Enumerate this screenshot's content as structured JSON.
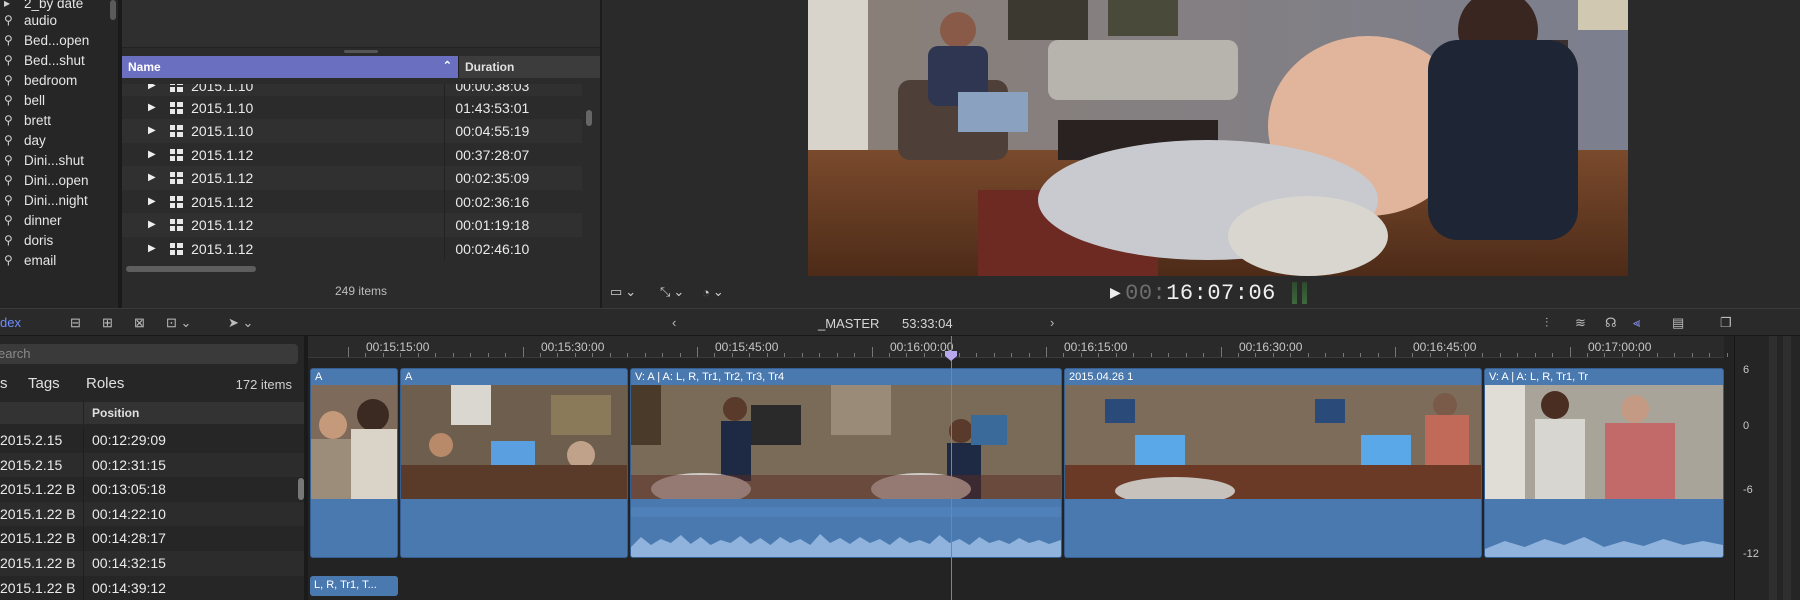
{
  "sidebar": {
    "items": [
      {
        "label": "2_by date",
        "icon": "folder-icon"
      },
      {
        "label": "audio",
        "icon": "keyword-icon"
      },
      {
        "label": "Bed...open",
        "icon": "keyword-icon"
      },
      {
        "label": "Bed...shut",
        "icon": "keyword-icon"
      },
      {
        "label": "bedroom",
        "icon": "keyword-icon"
      },
      {
        "label": "bell",
        "icon": "keyword-icon"
      },
      {
        "label": "brett",
        "icon": "keyword-icon"
      },
      {
        "label": "day",
        "icon": "keyword-icon"
      },
      {
        "label": "Dini...shut",
        "icon": "keyword-icon"
      },
      {
        "label": "Dini...open",
        "icon": "keyword-icon"
      },
      {
        "label": "Dini...night",
        "icon": "keyword-icon"
      },
      {
        "label": "dinner",
        "icon": "keyword-icon"
      },
      {
        "label": "doris",
        "icon": "keyword-icon"
      },
      {
        "label": "email",
        "icon": "keyword-icon"
      }
    ]
  },
  "browser": {
    "columns": {
      "name": "Name",
      "duration": "Duration"
    },
    "rows": [
      {
        "name": "2015.1.10",
        "duration": "00:00:38:03"
      },
      {
        "name": "2015.1.10",
        "duration": "01:43:53:01"
      },
      {
        "name": "2015.1.10",
        "duration": "00:04:55:19"
      },
      {
        "name": "2015.1.12",
        "duration": "00:37:28:07"
      },
      {
        "name": "2015.1.12",
        "duration": "00:02:35:09"
      },
      {
        "name": "2015.1.12",
        "duration": "00:02:36:16"
      },
      {
        "name": "2015.1.12",
        "duration": "00:01:19:18"
      },
      {
        "name": "2015.1.12",
        "duration": "00:02:46:10"
      }
    ],
    "item_count": "249 items"
  },
  "viewer": {
    "timecode_dim": "00:",
    "timecode_main": "16:07:06"
  },
  "toolbar": {
    "index_label": "dex",
    "project_name": "_MASTER",
    "project_duration": "53:33:04"
  },
  "index": {
    "search_placeholder": "earch",
    "tabs": {
      "clips": "s",
      "tags": "Tags",
      "roles": "Roles"
    },
    "count": "172 items",
    "position_header": "Position",
    "rows": [
      {
        "name": "2015.2.15",
        "position": "00:12:29:09"
      },
      {
        "name": "2015.2.15",
        "position": "00:12:31:15"
      },
      {
        "name": "2015.1.22 B",
        "position": "00:13:05:18"
      },
      {
        "name": "2015.1.22 B",
        "position": "00:14:22:10"
      },
      {
        "name": "2015.1.22 B",
        "position": "00:14:28:17"
      },
      {
        "name": "2015.1.22 B",
        "position": "00:14:32:15"
      },
      {
        "name": "2015.1.22 B",
        "position": "00:14:39:12"
      }
    ]
  },
  "timeline": {
    "ruler": [
      "00:15:15:00",
      "00:15:30:00",
      "00:15:45:00",
      "00:16:00:00",
      "00:16:15:00",
      "00:16:30:00",
      "00:16:45:00",
      "00:17:00:00"
    ],
    "clips": [
      {
        "title": "A"
      },
      {
        "title": "A"
      },
      {
        "title": "V: A | A: L, R, Tr1, Tr2, Tr3, Tr4"
      },
      {
        "title": "2015.04.26 1"
      },
      {
        "title": "V: A | A: L, R, Tr1, Tr"
      }
    ],
    "subclip": "L, R, Tr1, T..."
  },
  "meters": {
    "scale": [
      "6",
      "0",
      "-6",
      "-12"
    ]
  },
  "colors": {
    "accent": "#6a6fc0",
    "clip": "#4a79b0",
    "playhead": "#d9634a",
    "index_link": "#6f8cff"
  }
}
